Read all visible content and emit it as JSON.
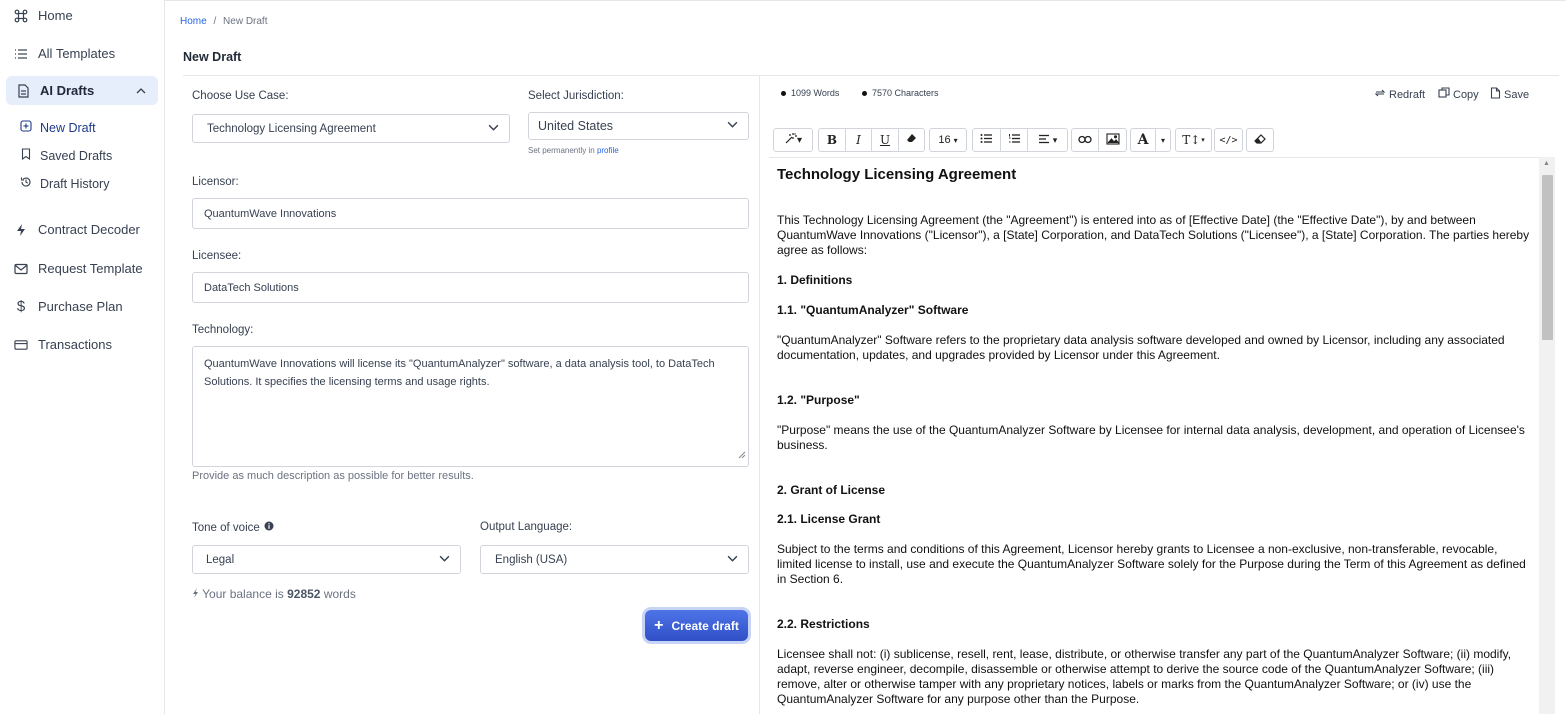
{
  "sidebar": {
    "items": [
      {
        "label": "Home",
        "icon": "command-icon"
      },
      {
        "label": "All Templates",
        "icon": "list-icon"
      },
      {
        "label": "AI Drafts",
        "icon": "document-icon"
      },
      {
        "label": "Contract Decoder",
        "icon": "lightning-icon"
      },
      {
        "label": "Request Template",
        "icon": "mail-icon"
      },
      {
        "label": "Purchase Plan",
        "icon": "dollar-icon"
      },
      {
        "label": "Transactions",
        "icon": "card-icon"
      }
    ],
    "sub_items": [
      {
        "label": "New Draft",
        "icon": "plus-square-icon"
      },
      {
        "label": "Saved Drafts",
        "icon": "bookmark-icon"
      },
      {
        "label": "Draft History",
        "icon": "history-icon"
      }
    ]
  },
  "breadcrumb": {
    "home": "Home",
    "separator": "/",
    "current": "New Draft"
  },
  "page_title": "New Draft",
  "form": {
    "use_case_label": "Choose Use Case:",
    "use_case_value": "Technology Licensing Agreement",
    "jurisdiction_label": "Select Jurisdiction:",
    "jurisdiction_value": "United States",
    "jurisdiction_hint": "Set permanently in",
    "jurisdiction_hint_link": "profile",
    "licensor_label": "Licensor:",
    "licensor_value": "QuantumWave Innovations",
    "licensee_label": "Licensee:",
    "licensee_value": "DataTech Solutions",
    "technology_label": "Technology:",
    "technology_value": "QuantumWave Innovations will license its \"QuantumAnalyzer\" software, a data analysis tool, to DataTech Solutions. It specifies the licensing terms and usage rights.",
    "description_note": "Provide as much description as possible for better results.",
    "tone_label": "Tone of voice",
    "tone_value": "Legal",
    "language_label": "Output Language:",
    "language_value": "English (USA)",
    "balance_prefix": "Your balance is",
    "balance_value": "92852",
    "balance_suffix": "words",
    "create_button": "Create draft"
  },
  "editor": {
    "word_count": "1099 Words",
    "char_count": "7570 Characters",
    "redraft": "Redraft",
    "copy": "Copy",
    "save": "Save",
    "font_size": "16",
    "toolbar": {
      "bold": "B",
      "italic": "I",
      "underline": "U",
      "text_color": "A",
      "text_size": "T↕",
      "code": "</>"
    }
  },
  "document": {
    "title": "Technology Licensing Agreement",
    "intro": "This Technology Licensing Agreement (the \"Agreement\") is entered into as of [Effective Date] (the \"Effective Date\"), by and between QuantumWave Innovations (\"Licensor\"), a [State] Corporation, and DataTech Solutions (\"Licensee\"), a [State] Corporation. The parties hereby agree as follows:",
    "h_definitions": "1. Definitions",
    "h_software": "1.1. \"QuantumAnalyzer\" Software",
    "p_software": "\"QuantumAnalyzer\" Software refers to the proprietary data analysis software developed and owned by Licensor, including any associated documentation, updates, and upgrades provided by Licensor under this Agreement.",
    "h_purpose": "1.2. \"Purpose\"",
    "p_purpose": "\"Purpose\" means the use of the QuantumAnalyzer Software by Licensee for internal data analysis, development, and operation of Licensee's business.",
    "h_grant": "2. Grant of License",
    "h_license_grant": "2.1. License Grant",
    "p_license_grant": "Subject to the terms and conditions of this Agreement, Licensor hereby grants to Licensee a non-exclusive, non-transferable, revocable, limited license to install, use and execute the QuantumAnalyzer Software solely for the Purpose during the Term of this Agreement as defined in Section 6.",
    "h_restrictions": "2.2. Restrictions",
    "p_restrictions": "Licensee shall not: (i) sublicense, resell, rent, lease, distribute, or otherwise transfer any part of the QuantumAnalyzer Software; (ii) modify, adapt, reverse engineer, decompile, disassemble or otherwise attempt to derive the source code of the QuantumAnalyzer Software; (iii) remove, alter or otherwise tamper with any proprietary notices, labels or marks from the QuantumAnalyzer Software; or (iv) use the QuantumAnalyzer Software for any purpose other than the Purpose."
  },
  "colors": {
    "accent": "#2563eb",
    "active_bg": "#e6edfb",
    "button": "#3b5fd8"
  }
}
